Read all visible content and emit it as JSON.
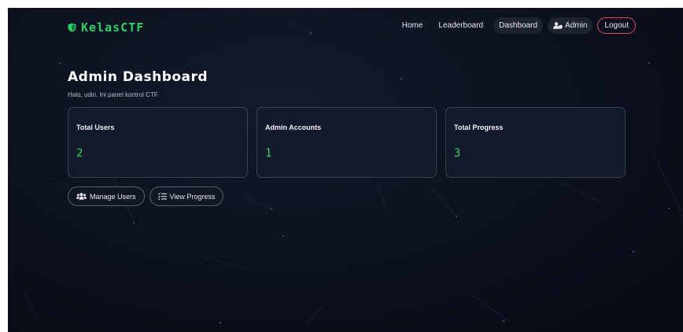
{
  "brand": {
    "name": "KelasCTF",
    "icon": "shield-icon"
  },
  "nav": {
    "home": "Home",
    "leaderboard": "Leaderboard",
    "dashboard": "Dashboard",
    "admin": "Admin",
    "logout": "Logout"
  },
  "header": {
    "title": "Admin Dashboard",
    "subtitle": "Halo, udin. Ini panel kontrol CTF."
  },
  "cards": [
    {
      "title": "Total Users",
      "value": "2"
    },
    {
      "title": "Admin Accounts",
      "value": "1"
    },
    {
      "title": "Total Progress",
      "value": "3"
    }
  ],
  "actions": {
    "manage_users": "Manage Users",
    "view_progress": "View Progress"
  },
  "colors": {
    "accent": "#2fd167",
    "background": "#0c111e",
    "logout_border": "#e0496b",
    "card_border": "#39404f"
  }
}
